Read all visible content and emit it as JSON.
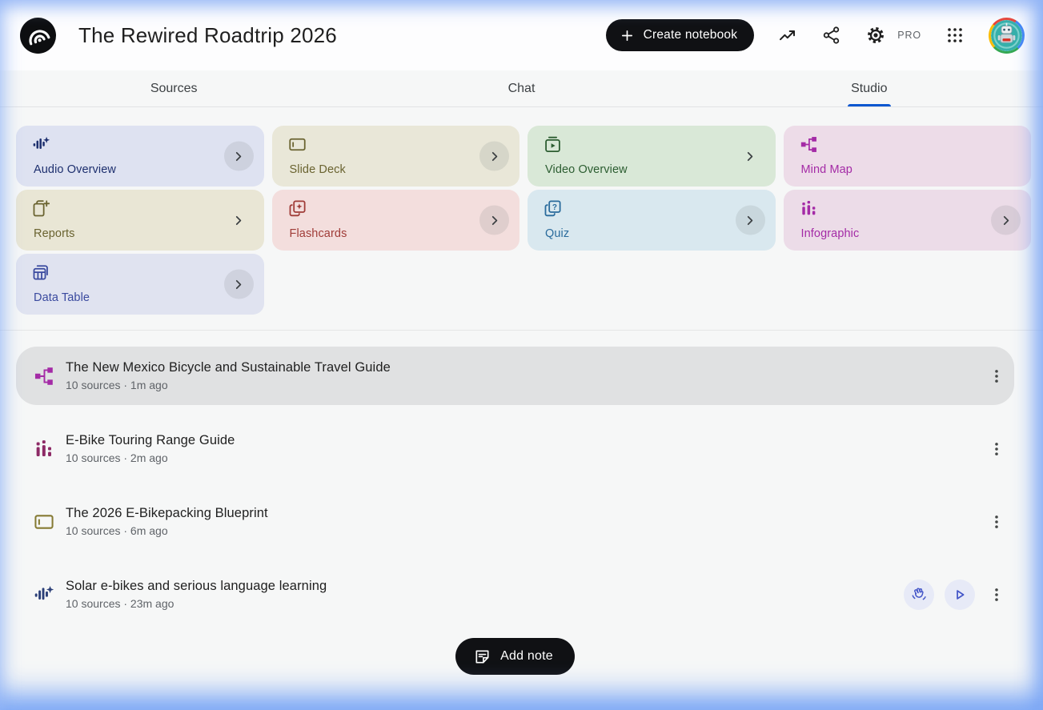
{
  "header": {
    "title": "The Rewired Roadtrip 2026",
    "create_button_label": "Create notebook",
    "pro_badge": "PRO"
  },
  "tabs": [
    {
      "label": "Sources",
      "active": false
    },
    {
      "label": "Chat",
      "active": false
    },
    {
      "label": "Studio",
      "active": true
    }
  ],
  "colors": {
    "accent_blue": "#0b57d0",
    "edge_glow_blue": "#8fb5f5",
    "selected_row_grey": "#e0e1e2",
    "pill_black": "#101114"
  },
  "studio_cards": [
    {
      "label": "Audio Overview",
      "icon": "audio-waveform-sparkle-icon",
      "bg": "#dee2f1",
      "fg": "#1d2f6e",
      "chevron": "circle"
    },
    {
      "label": "Slide Deck",
      "icon": "slide-deck-icon",
      "bg": "#e9e7d8",
      "fg": "#6a6330",
      "chevron": "circle"
    },
    {
      "label": "Video Overview",
      "icon": "video-overview-icon",
      "bg": "#d9e8d7",
      "fg": "#2c5d31",
      "chevron": "plain"
    },
    {
      "label": "Mind Map",
      "icon": "mind-map-icon",
      "bg": "#eddce8",
      "fg": "#a42ba6",
      "chevron": "none"
    },
    {
      "label": "Reports",
      "icon": "reports-icon",
      "bg": "#e9e6d5",
      "fg": "#6a6330",
      "chevron": "plain"
    },
    {
      "label": "Flashcards",
      "icon": "flashcards-icon",
      "bg": "#f3dedd",
      "fg": "#a03c38",
      "chevron": "circle"
    },
    {
      "label": "Quiz",
      "icon": "quiz-icon",
      "bg": "#d9e8ef",
      "fg": "#2a6b9c",
      "chevron": "circle"
    },
    {
      "label": "Infographic",
      "icon": "infographic-icon",
      "bg": "#ecdce8",
      "fg": "#a42ba6",
      "chevron": "circle"
    },
    {
      "label": "Data Table",
      "icon": "data-table-icon",
      "bg": "#e0e3f0",
      "fg": "#3a4a9f",
      "chevron": "circle"
    }
  ],
  "studio_items": [
    {
      "icon": "mind-map-icon",
      "icon_color": "#a42ba6",
      "title": "The New Mexico Bicycle and Sustainable Travel Guide",
      "meta": "10 sources · 1m ago",
      "selected": true
    },
    {
      "icon": "infographic-icon",
      "icon_color": "#8d2a66",
      "title": "E-Bike Touring Range Guide",
      "meta": "10 sources · 2m ago",
      "selected": false
    },
    {
      "icon": "slide-deck-icon",
      "icon_color": "#857a33",
      "title": "The 2026 E-Bikepacking Blueprint",
      "meta": "10 sources · 6m ago",
      "selected": false
    },
    {
      "icon": "audio-waveform-sparkle-icon",
      "icon_color": "#2b3f77",
      "title": "Solar e-bikes and serious language learning",
      "meta": "10 sources · 23m ago",
      "selected": false,
      "actions": [
        {
          "icon": "interactive-mode-hand-icon"
        },
        {
          "icon": "play-icon"
        }
      ]
    }
  ],
  "add_note_label": "Add note"
}
